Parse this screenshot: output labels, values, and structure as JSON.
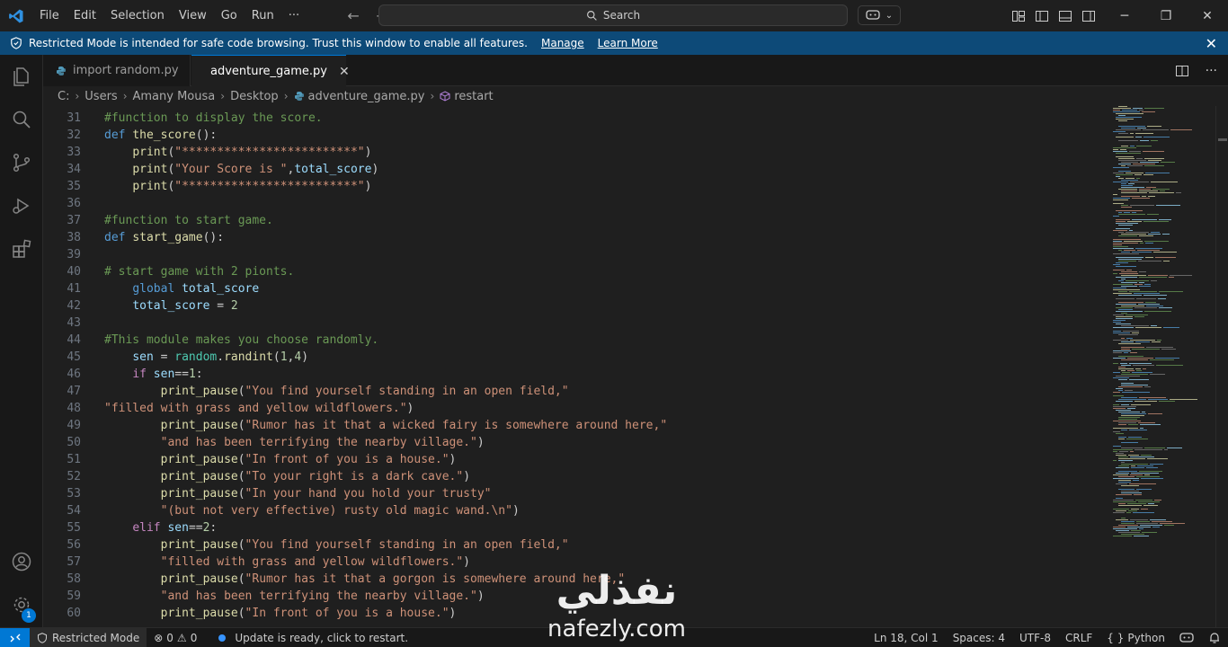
{
  "titlebar": {
    "menu": [
      "File",
      "Edit",
      "Selection",
      "View",
      "Go",
      "Run",
      "···"
    ],
    "search_label": "Search"
  },
  "banner": {
    "message": "Restricted Mode is intended for safe code browsing. Trust this window to enable all features.",
    "manage": "Manage",
    "learn_more": "Learn More"
  },
  "tabs": [
    {
      "label": "import random.py",
      "active": false
    },
    {
      "label": "adventure_game.py",
      "active": true
    }
  ],
  "breadcrumb": [
    "C:",
    "Users",
    "Amany Mousa",
    "Desktop",
    "adventure_game.py",
    "restart"
  ],
  "editor": {
    "lines": [
      {
        "n": "31",
        "code": "#function to display the score."
      },
      {
        "n": "32",
        "code": "def the_score():"
      },
      {
        "n": "33",
        "code": "    print(\"*************************\")"
      },
      {
        "n": "34",
        "code": "    print(\"Your Score is \",total_score)"
      },
      {
        "n": "35",
        "code": "    print(\"*************************\")"
      },
      {
        "n": "36",
        "code": ""
      },
      {
        "n": "37",
        "code": "#function to start game."
      },
      {
        "n": "38",
        "code": "def start_game():"
      },
      {
        "n": "39",
        "code": ""
      },
      {
        "n": "40",
        "code": "# start game with 2 pionts."
      },
      {
        "n": "41",
        "code": "    global total_score"
      },
      {
        "n": "42",
        "code": "    total_score = 2"
      },
      {
        "n": "43",
        "code": ""
      },
      {
        "n": "44",
        "code": "#This module makes you choose randomly."
      },
      {
        "n": "45",
        "code": "    sen = random.randint(1,4)"
      },
      {
        "n": "46",
        "code": "    if sen==1:"
      },
      {
        "n": "47",
        "code": "        print_pause(\"You find yourself standing in an open field,\""
      },
      {
        "n": "48",
        "code": "\"filled with grass and yellow wildflowers.\")"
      },
      {
        "n": "49",
        "code": "        print_pause(\"Rumor has it that a wicked fairy is somewhere around here,\""
      },
      {
        "n": "50",
        "code": "        \"and has been terrifying the nearby village.\")"
      },
      {
        "n": "51",
        "code": "        print_pause(\"In front of you is a house.\")"
      },
      {
        "n": "52",
        "code": "        print_pause(\"To your right is a dark cave.\")"
      },
      {
        "n": "53",
        "code": "        print_pause(\"In your hand you hold your trusty\""
      },
      {
        "n": "54",
        "code": "        \"(but not very effective) rusty old magic wand.\\n\")"
      },
      {
        "n": "55",
        "code": "    elif sen==2:"
      },
      {
        "n": "56",
        "code": "        print_pause(\"You find yourself standing in an open field,\""
      },
      {
        "n": "57",
        "code": "        \"filled with grass and yellow wildflowers.\")"
      },
      {
        "n": "58",
        "code": "        print_pause(\"Rumor has it that a gorgon is somewhere around here,\""
      },
      {
        "n": "59",
        "code": "        \"and has been terrifying the nearby village.\")"
      },
      {
        "n": "60",
        "code": "        print_pause(\"In front of you is a house.\")"
      }
    ]
  },
  "statusbar": {
    "restricted": "Restricted Mode",
    "errors": "0",
    "warnings": "0",
    "update": "Update is ready, click to restart.",
    "position": "Ln 18, Col 1",
    "spaces": "Spaces: 4",
    "encoding": "UTF-8",
    "eol": "CRLF",
    "language": "Python"
  },
  "activity_badge": "1",
  "watermark": {
    "arabic": "نفذلي",
    "latin": "nafezly.com"
  },
  "colors": {
    "accent": "#0078d4",
    "banner": "#0d4a78",
    "background": "#1f1f1f"
  }
}
